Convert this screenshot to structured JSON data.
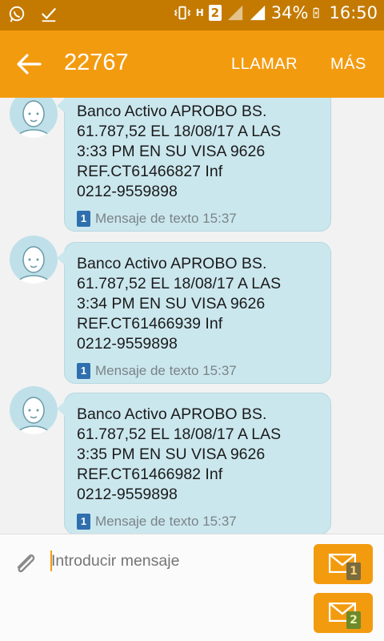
{
  "status_bar": {
    "battery": "34%",
    "time": "16:50",
    "sim_slot": "2",
    "network_type": "H",
    "icons": [
      "whatsapp-icon",
      "check-icon",
      "vibrate-icon",
      "network-h-icon",
      "sim2-icon",
      "signal-icon",
      "signal-icon",
      "battery-charging-icon"
    ]
  },
  "app_bar": {
    "title": "22767",
    "call_label": "LLAMAR",
    "more_label": "MÁS",
    "accent_color": "#f39b0f"
  },
  "messages": [
    {
      "text": "Banco Activo APROBO BS.\n61.787,52 EL 18/08/17 A LAS\n3:33 PM EN SU VISA 9626\nREF.CT61466827 Inf\n0212-9559898",
      "sim": "1",
      "meta": "Mensaje de texto 15:37"
    },
    {
      "text": "Banco Activo APROBO BS.\n61.787,52 EL 18/08/17 A LAS\n3:34 PM EN SU VISA 9626\nREF.CT61466939 Inf\n0212-9559898",
      "sim": "1",
      "meta": "Mensaje de texto 15:37"
    },
    {
      "text": "Banco Activo APROBO BS.\n61.787,52 EL 18/08/17 A LAS\n3:35 PM EN SU VISA 9626\nREF.CT61466982 Inf\n0212-9559898",
      "sim": "1",
      "meta": "Mensaje de texto 15:37"
    }
  ],
  "composer": {
    "placeholder": "Introducir mensaje",
    "send_sim1": "1",
    "send_sim2": "2"
  }
}
